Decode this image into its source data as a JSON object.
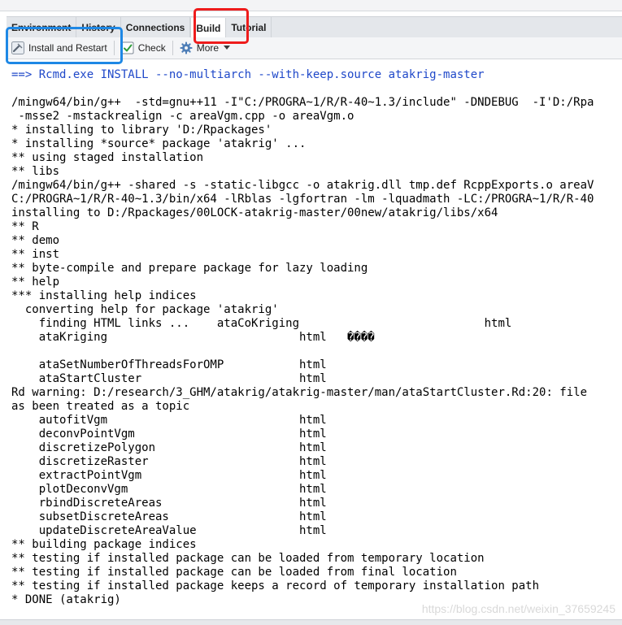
{
  "tabs": [
    {
      "label": "Environment",
      "active": false
    },
    {
      "label": "History",
      "active": false
    },
    {
      "label": "Connections",
      "active": false
    },
    {
      "label": "Build",
      "active": true
    },
    {
      "label": "Tutorial",
      "active": false
    }
  ],
  "toolbar": {
    "install_label": "Install and Restart",
    "install_icon": "hammer-icon",
    "check_label": "Check",
    "check_icon": "checkbox-icon",
    "more_label": "More",
    "more_icon": "gear-icon",
    "more_caret_icon": "caret-down-icon"
  },
  "colors": {
    "command_text": "#1f48c9",
    "highlight_red": "#ee1c1c",
    "highlight_blue": "#1e88e5"
  },
  "console": {
    "command": "==> Rcmd.exe INSTALL --no-multiarch --with-keep.source atakrig-master",
    "lines": [
      "",
      "/mingw64/bin/g++  -std=gnu++11 -I\"C:/PROGRA~1/R/R-40~1.3/include\" -DNDEBUG  -I'D:/Rpa",
      " -msse2 -mstackrealign -c areaVgm.cpp -o areaVgm.o",
      "* installing to library 'D:/Rpackages'",
      "* installing *source* package 'atakrig' ...",
      "** using staged installation",
      "** libs",
      "/mingw64/bin/g++ -shared -s -static-libgcc -o atakrig.dll tmp.def RcppExports.o areaV",
      "C:/PROGRA~1/R/R-40~1.3/bin/x64 -lRblas -lgfortran -lm -lquadmath -LC:/PROGRA~1/R/R-40",
      "installing to D:/Rpackages/00LOCK-atakrig-master/00new/atakrig/libs/x64",
      "** R",
      "** demo",
      "** inst",
      "** byte-compile and prepare package for lazy loading",
      "** help",
      "*** installing help indices",
      "  converting help for package 'atakrig'",
      "    finding HTML links ...    ataCoKriging                           html",
      "    ataKriging                            html   ����",
      "",
      "    ataSetNumberOfThreadsForOMP           html",
      "    ataStartCluster                       html",
      "Rd warning: D:/research/3_GHM/atakrig/atakrig-master/man/ataStartCluster.Rd:20: file",
      "as been treated as a topic",
      "    autofitVgm                            html",
      "    deconvPointVgm                        html",
      "    discretizePolygon                     html",
      "    discretizeRaster                      html",
      "    extractPointVgm                       html",
      "    plotDeconvVgm                         html",
      "    rbindDiscreteAreas                    html",
      "    subsetDiscreteAreas                   html",
      "    updateDiscreteAreaValue               html",
      "** building package indices",
      "** testing if installed package can be loaded from temporary location",
      "** testing if installed package can be loaded from final location",
      "** testing if installed package keeps a record of temporary installation path",
      "* DONE (atakrig)"
    ]
  },
  "watermark": "https://blog.csdn.net/weixin_37659245"
}
